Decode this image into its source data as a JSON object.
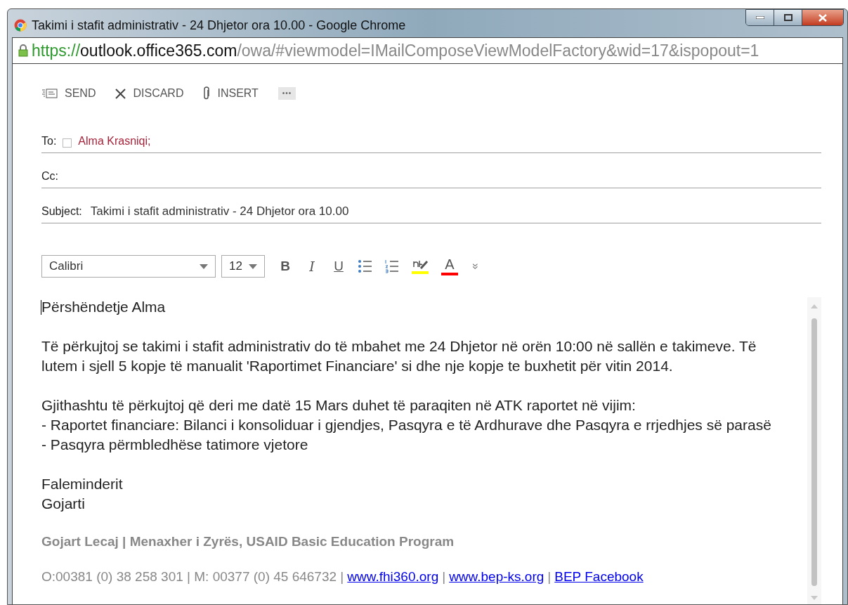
{
  "window": {
    "title": "Takimi i stafit administrativ - 24 Dhjetor ora 10.00 - Google Chrome"
  },
  "address_bar": {
    "scheme": "https://",
    "host": "outlook.office365.com",
    "path": "/owa/#viewmodel=IMailComposeViewModelFactory&wid=17&ispopout=1"
  },
  "actions": [
    {
      "kind": "send",
      "label": "SEND"
    },
    {
      "kind": "discard",
      "label": "DISCARD"
    },
    {
      "kind": "insert",
      "label": "INSERT"
    },
    {
      "kind": "more",
      "label": "•••"
    }
  ],
  "fields": [
    {
      "kind": "recipients",
      "label": "To:",
      "recipients": [
        {
          "name": "Alma Krasniqi;",
          "checked": false
        }
      ]
    },
    {
      "kind": "recipients",
      "label": "Cc:"
    },
    {
      "kind": "subject",
      "label": "Subject:",
      "value": "Takimi i stafit administrativ - 24 Dhjetor ora 10.00"
    }
  ],
  "format_toolbar": {
    "font": "Calibri",
    "size": "12",
    "buttons": [
      {
        "kind": "bold",
        "label": "B"
      },
      {
        "kind": "italic",
        "label": "I"
      },
      {
        "kind": "underline",
        "label": "U"
      },
      {
        "kind": "bullets"
      },
      {
        "kind": "numbering"
      },
      {
        "kind": "highlight",
        "color": "#ffff00"
      },
      {
        "kind": "font_color",
        "label": "A",
        "color": "#ff0000"
      },
      {
        "kind": "expand",
        "label": "»"
      }
    ]
  },
  "body": [
    {
      "lines": [
        "Përshëndetje Alma"
      ]
    },
    {
      "lines": [
        "Të përkujtoj se takimi i stafit administrativ do të mbahet me 24 Dhjetor në orën 10:00 në sallën e takimeve. Të",
        "lutem i sjell 5 kopje të manualit 'Raportimet Financiare' si dhe nje kopje te buxhetit për vitin 2014."
      ]
    },
    {
      "lines": [
        "Gjithashtu të përkujtoj që deri me datë 15 Mars duhet të paraqiten në ATK raportet në vijim:",
        "- Raportet financiare: Bilanci i konsoliduar i gjendjes, Pasqyra e të Ardhurave dhe Pasqyra e rrjedhjes së parasë",
        "- Pasqyra përmbledhëse tatimore vjetore"
      ]
    },
    {
      "lines": [
        "Faleminderit",
        "Gojarti"
      ]
    }
  ],
  "signature": {
    "title_line": "Gojart Lecaj | Menaxher i Zyrës, USAID Basic Education Program",
    "contact": [
      {
        "kind": "text",
        "text": "O:00381 (0) 38 258 301 | M: 00377 (0) 45 646732 |"
      },
      {
        "kind": "link",
        "text": "www.fhi360.org"
      },
      {
        "kind": "text",
        "text": "|"
      },
      {
        "kind": "link",
        "text": "www.bep-ks.org"
      },
      {
        "kind": "text",
        "text": "|"
      },
      {
        "kind": "link",
        "text": "BEP Facebook"
      }
    ]
  }
}
